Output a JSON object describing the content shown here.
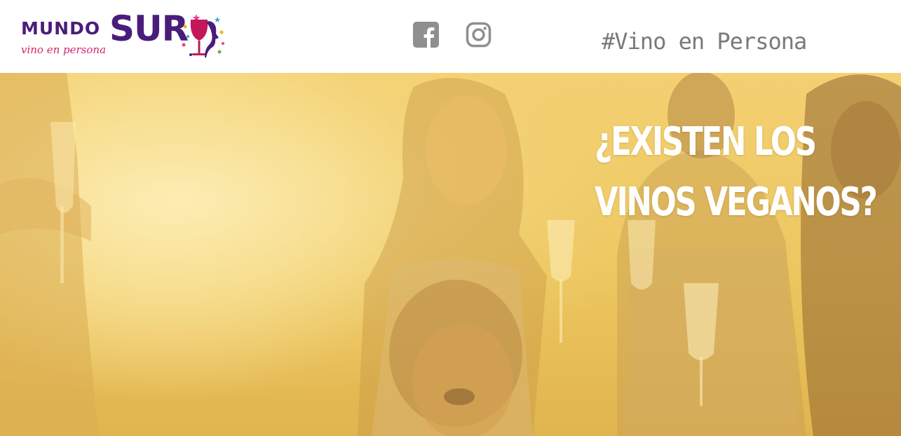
{
  "header": {
    "logo": {
      "word_mundo": "MUNDO",
      "word_sur": "SUR",
      "tagline": "vino en persona",
      "brand_purple": "#4a1d7a",
      "brand_pink": "#d6246e"
    },
    "social": [
      {
        "name": "facebook",
        "icon": "facebook-icon"
      },
      {
        "name": "instagram",
        "icon": "instagram-icon"
      }
    ],
    "hashtag": "#Vino en Persona"
  },
  "hero": {
    "title_line1": "¿EXISTEN LOS",
    "title_line2": "VINOS VEGANOS?",
    "overlay_color": "#f3d175"
  }
}
